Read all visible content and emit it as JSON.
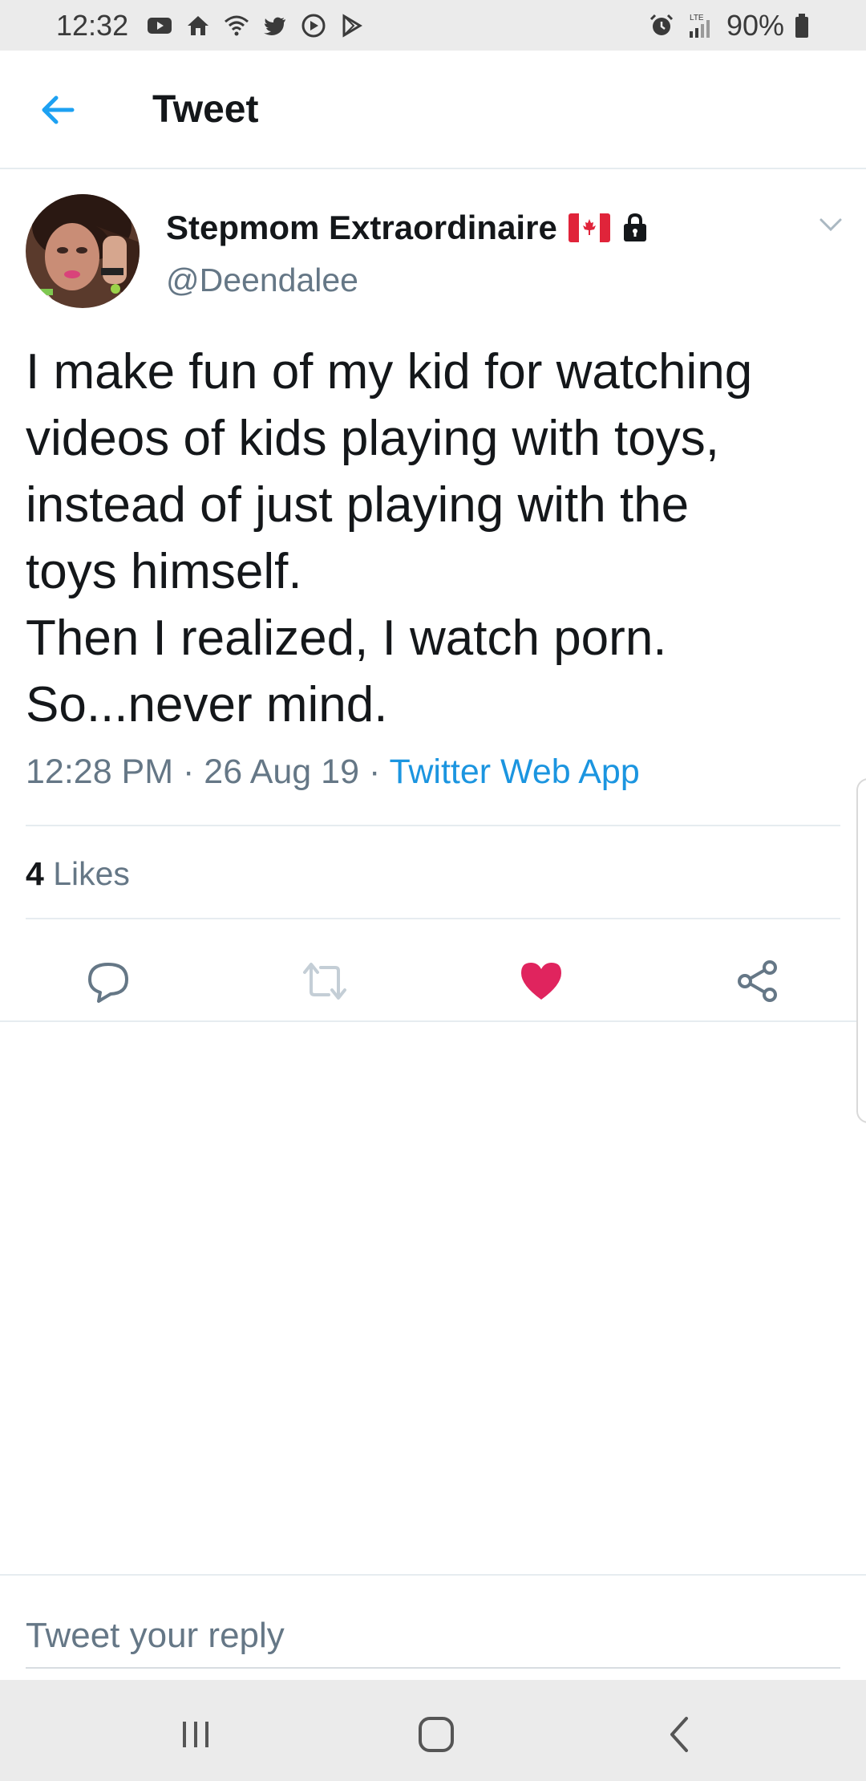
{
  "status_bar": {
    "time": "12:32",
    "battery": "90%",
    "network": "LTE",
    "icons_left": [
      "youtube-icon",
      "home-icon",
      "wifi-icon",
      "twitter-icon",
      "vpn-icon",
      "play-store-icon"
    ],
    "icons_right": [
      "alarm-icon",
      "signal-icon",
      "battery-icon"
    ]
  },
  "header": {
    "title": "Tweet",
    "back_icon": "arrow-left-icon"
  },
  "tweet": {
    "author_name": "Stepmom Extraordinaire",
    "author_badges": [
      "canada-flag-icon",
      "lock-icon"
    ],
    "handle": "@Deendalee",
    "text_lines": [
      "I make fun of my kid for watching",
      "videos of kids playing with toys,",
      "instead of just playing with the",
      "toys himself.",
      "Then I realized, I watch porn.",
      "So...never mind."
    ],
    "time": "12:28 PM",
    "date": "26 Aug 19",
    "separator": "·",
    "source": "Twitter Web App",
    "likes_count": "4",
    "likes_label": "Likes",
    "liked": true
  },
  "actions": [
    "reply-icon",
    "retweet-icon",
    "like-icon",
    "share-icon"
  ],
  "reply": {
    "placeholder": "Tweet your reply"
  },
  "colors": {
    "accent": "#1da1f2",
    "like": "#e0245e",
    "secondary_text": "#657786",
    "link": "#1b95e0"
  },
  "nav_bar": [
    "recent-apps-icon",
    "home-button-icon",
    "back-icon"
  ]
}
